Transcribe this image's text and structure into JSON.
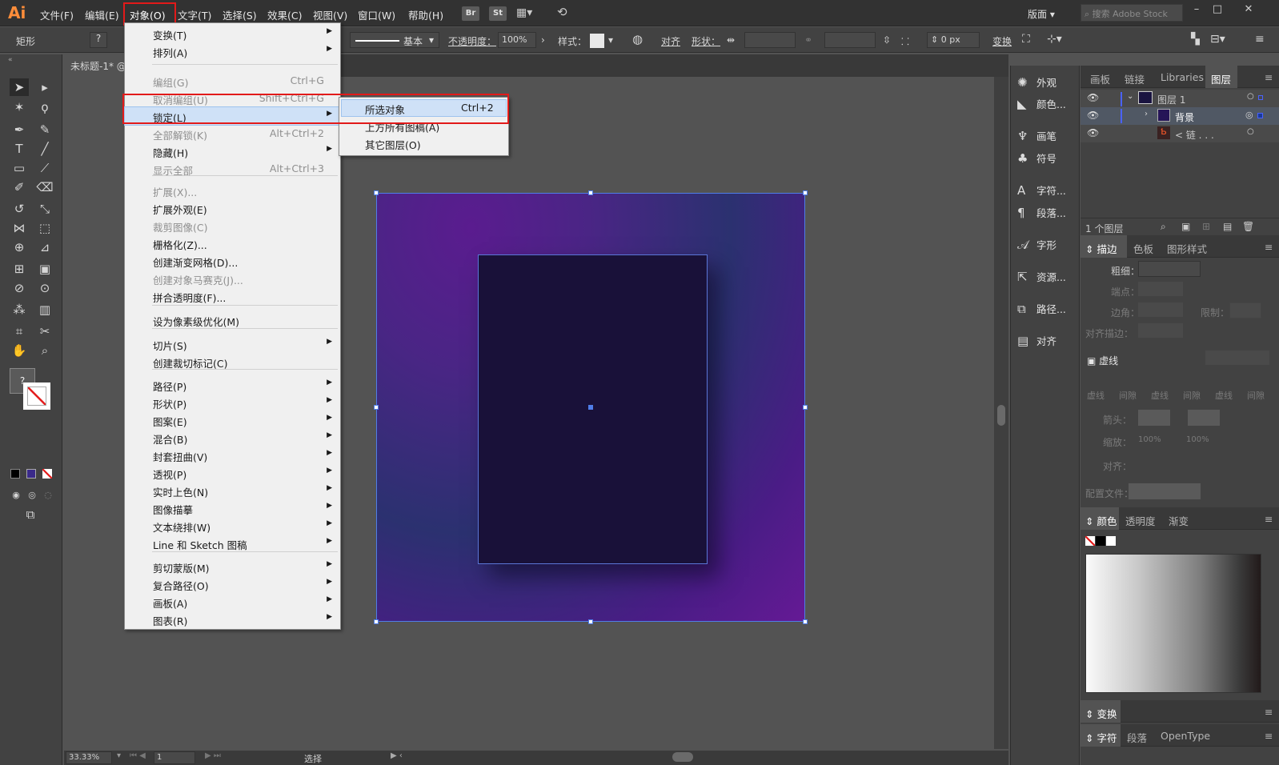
{
  "menubar": {
    "logo": "Ai",
    "items": [
      "文件(F)",
      "编辑(E)",
      "对象(O)",
      "文字(T)",
      "选择(S)",
      "效果(C)",
      "视图(V)",
      "窗口(W)",
      "帮助(H)"
    ],
    "br": "Br",
    "st": "St",
    "workspace": "版面",
    "search_placeholder": "搜索 Adobe Stock"
  },
  "control": {
    "tool": "矩形",
    "stroke_style": "基本",
    "opacity_label": "不透明度：",
    "opacity": "100%",
    "style_label": "样式：",
    "align": "对齐",
    "shape_label": "形状：",
    "px_value": "0 px",
    "transform": "变换"
  },
  "doc": {
    "tab": "未标题-1* @"
  },
  "canvas": {
    "artboard_gradient": "#5a1c8f",
    "inner_fill": "#191139"
  },
  "status": {
    "zoom": "33.33%",
    "page": "1",
    "mode": "选择"
  },
  "menu": {
    "items": [
      {
        "label": "变换(T)",
        "shortcut": "",
        "arrow": "▶",
        "disabled": false
      },
      {
        "label": "排列(A)",
        "shortcut": "",
        "arrow": "▶",
        "disabled": false
      },
      {
        "label": "编组(G)",
        "shortcut": "Ctrl+G",
        "arrow": "",
        "disabled": true
      },
      {
        "label": "取消编组(U)",
        "shortcut": "Shift+Ctrl+G",
        "arrow": "",
        "disabled": true
      },
      {
        "label": "锁定(L)",
        "shortcut": "",
        "arrow": "▶",
        "disabled": false
      },
      {
        "label": "全部解锁(K)",
        "shortcut": "Alt+Ctrl+2",
        "arrow": "",
        "disabled": true
      },
      {
        "label": "隐藏(H)",
        "shortcut": "",
        "arrow": "▶",
        "disabled": false
      },
      {
        "label": "显示全部",
        "shortcut": "Alt+Ctrl+3",
        "arrow": "",
        "disabled": true
      },
      {
        "label": "扩展(X)...",
        "shortcut": "",
        "arrow": "",
        "disabled": true
      },
      {
        "label": "扩展外观(E)",
        "shortcut": "",
        "arrow": "",
        "disabled": false
      },
      {
        "label": "裁剪图像(C)",
        "shortcut": "",
        "arrow": "",
        "disabled": true
      },
      {
        "label": "栅格化(Z)...",
        "shortcut": "",
        "arrow": "",
        "disabled": false
      },
      {
        "label": "创建渐变网格(D)...",
        "shortcut": "",
        "arrow": "",
        "disabled": false
      },
      {
        "label": "创建对象马赛克(J)...",
        "shortcut": "",
        "arrow": "",
        "disabled": true
      },
      {
        "label": "拼合透明度(F)...",
        "shortcut": "",
        "arrow": "",
        "disabled": false
      },
      {
        "label": "设为像素级优化(M)",
        "shortcut": "",
        "arrow": "",
        "disabled": false
      },
      {
        "label": "切片(S)",
        "shortcut": "",
        "arrow": "▶",
        "disabled": false
      },
      {
        "label": "创建裁切标记(C)",
        "shortcut": "",
        "arrow": "",
        "disabled": false
      },
      {
        "label": "路径(P)",
        "shortcut": "",
        "arrow": "▶",
        "disabled": false
      },
      {
        "label": "形状(P)",
        "shortcut": "",
        "arrow": "▶",
        "disabled": false
      },
      {
        "label": "图案(E)",
        "shortcut": "",
        "arrow": "▶",
        "disabled": false
      },
      {
        "label": "混合(B)",
        "shortcut": "",
        "arrow": "▶",
        "disabled": false
      },
      {
        "label": "封套扭曲(V)",
        "shortcut": "",
        "arrow": "▶",
        "disabled": false
      },
      {
        "label": "透视(P)",
        "shortcut": "",
        "arrow": "▶",
        "disabled": false
      },
      {
        "label": "实时上色(N)",
        "shortcut": "",
        "arrow": "▶",
        "disabled": false
      },
      {
        "label": "图像描摹",
        "shortcut": "",
        "arrow": "▶",
        "disabled": false
      },
      {
        "label": "文本绕排(W)",
        "shortcut": "",
        "arrow": "▶",
        "disabled": false
      },
      {
        "label": "Line 和 Sketch 图稿",
        "shortcut": "",
        "arrow": "▶",
        "disabled": false
      },
      {
        "label": "剪切蒙版(M)",
        "shortcut": "",
        "arrow": "▶",
        "disabled": false
      },
      {
        "label": "复合路径(O)",
        "shortcut": "",
        "arrow": "▶",
        "disabled": false
      },
      {
        "label": "画板(A)",
        "shortcut": "",
        "arrow": "▶",
        "disabled": false
      },
      {
        "label": "图表(R)",
        "shortcut": "",
        "arrow": "▶",
        "disabled": false
      }
    ]
  },
  "submenu": {
    "items": [
      {
        "label": "所选对象",
        "shortcut": "Ctrl+2"
      },
      {
        "label": "上方所有图稿(A)",
        "shortcut": ""
      },
      {
        "label": "其它图层(O)",
        "shortcut": ""
      }
    ]
  },
  "dock": {
    "items": [
      "外观",
      "颜色...",
      "画笔",
      "符号",
      "字符...",
      "段落...",
      "字形",
      "资源...",
      "路径...",
      "对齐"
    ]
  },
  "layers": {
    "tabs": [
      "画板",
      "链接",
      "Libraries",
      "图层"
    ],
    "layer1": "图层 1",
    "bg": "背景",
    "link": "< 链 . . .",
    "count": "1 个图层"
  },
  "stroke": {
    "tabs": [
      "描边",
      "色板",
      "图形样式"
    ],
    "weight": "粗细：",
    "cap": "端点：",
    "corner": "边角：",
    "limit": "限制：",
    "align": "对齐描边：",
    "dashed": "虚线",
    "dash": "虚线",
    "gap": "间隙",
    "arrow": "箭头：",
    "scale": "缩放：",
    "scale_val": "100%",
    "align2": "对齐：",
    "profile": "配置文件："
  },
  "color": {
    "tabs": [
      "颜色",
      "透明度",
      "渐变"
    ]
  },
  "bottom": {
    "transform": "变换",
    "char_tabs": [
      "字符",
      "段落",
      "OpenType"
    ]
  }
}
